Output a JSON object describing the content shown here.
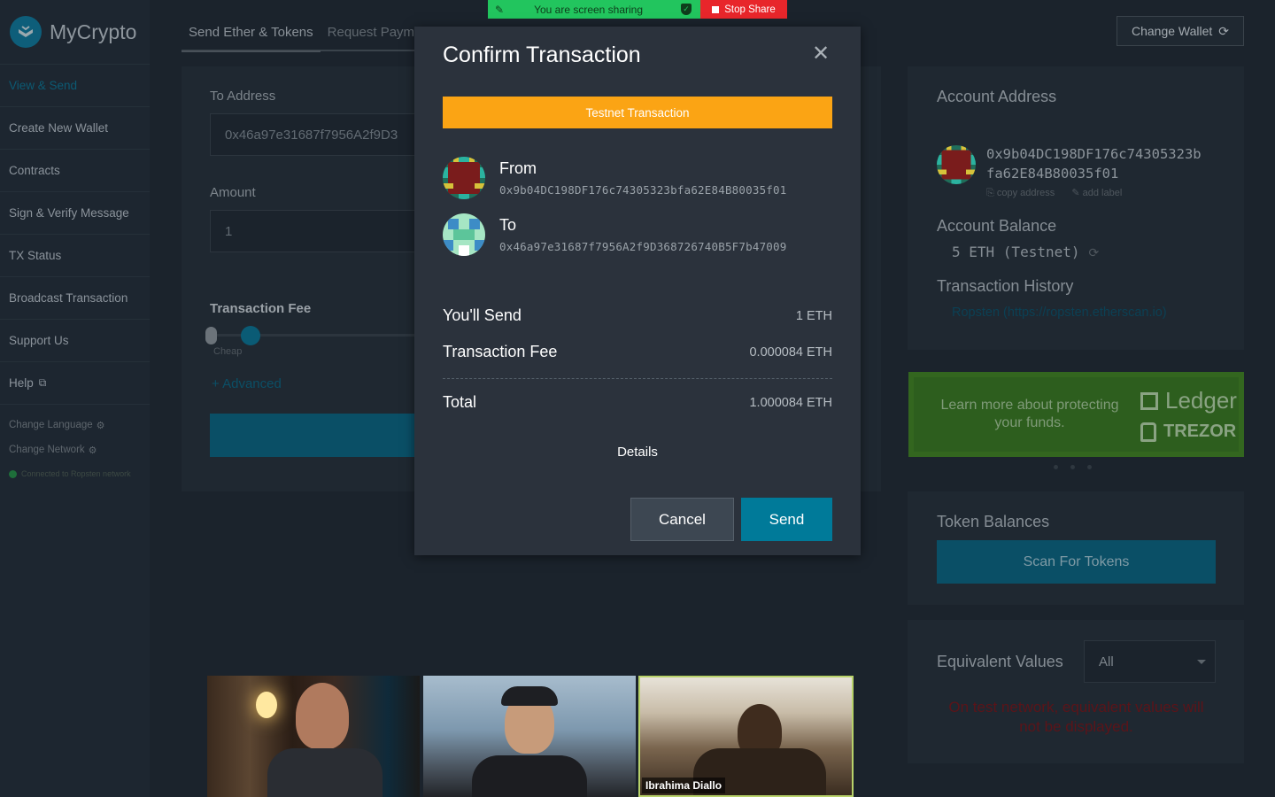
{
  "app": {
    "name": "MyCrypto"
  },
  "sidebar": {
    "items": [
      {
        "label": "View & Send"
      },
      {
        "label": "Create New Wallet"
      },
      {
        "label": "Contracts"
      },
      {
        "label": "Sign & Verify Message"
      },
      {
        "label": "TX Status"
      },
      {
        "label": "Broadcast Transaction"
      },
      {
        "label": "Support Us"
      },
      {
        "label": "Help"
      }
    ],
    "change_language": "Change Language",
    "change_network": "Change Network",
    "network_status": "Connected to Ropsten network"
  },
  "main": {
    "tabs": [
      {
        "label": "Send Ether & Tokens"
      },
      {
        "label": "Request Paym"
      }
    ],
    "to_address_label": "To Address",
    "to_address_value": "0x46a97e31687f7956A2f9D3",
    "amount_label": "Amount",
    "amount_value": "1",
    "fee_label": "Transaction Fee",
    "fee_cheap": "Cheap",
    "advanced": "+ Advanced"
  },
  "right": {
    "change_wallet": "Change Wallet",
    "account_address_h": "Account Address",
    "account_address": "0x9b04DC198DF176c74305323bfa62E84B80035f01",
    "copy_address": "copy address",
    "add_label": "add label",
    "account_balance_h": "Account Balance",
    "balance": "5 ETH (Testnet)",
    "history_h": "Transaction History",
    "history_link": "Ropsten (https://ropsten.etherscan.io)",
    "promo_text": "Learn more about protecting your funds.",
    "promo_ledger": "Ledger",
    "promo_trezor": "TREZOR",
    "token_balances_h": "Token Balances",
    "scan_tokens": "Scan For Tokens",
    "equiv_h": "Equivalent Values",
    "equiv_select": "All",
    "equiv_warning": "On test network, equivalent values will not be displayed."
  },
  "share_bar": {
    "status": "You are screen sharing",
    "stop": "Stop Share",
    "colors": {
      "green": "#22c55e",
      "red": "#e8262b"
    }
  },
  "modal": {
    "title": "Confirm Transaction",
    "testnet_banner": "Testnet Transaction",
    "from_label": "From",
    "from_addr": "0x9b04DC198DF176c74305323bfa62E84B80035f01",
    "to_label": "To",
    "to_addr": "0x46a97e31687f7956A2f9D368726740B5F7b47009",
    "send_k": "You'll Send",
    "send_v": "1 ETH",
    "fee_k": "Transaction Fee",
    "fee_v": "0.000084 ETH",
    "total_k": "Total",
    "total_v": "1.000084 ETH",
    "details": "Details",
    "cancel": "Cancel",
    "send": "Send",
    "colors": {
      "accent": "#007a99",
      "banner": "#fba414"
    }
  },
  "video": {
    "participant_3_name": "Ibrahima Diallo"
  }
}
